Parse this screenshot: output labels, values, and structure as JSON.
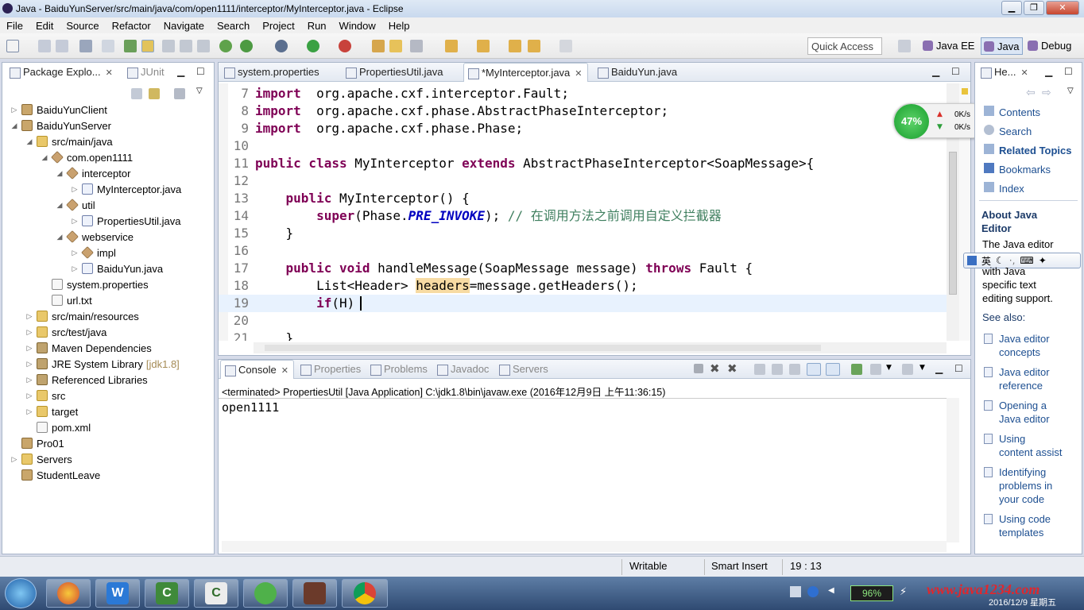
{
  "window": {
    "title": "Java - BaiduYunServer/src/main/java/com/open1111/interceptor/MyInterceptor.java - Eclipse"
  },
  "menu": [
    "File",
    "Edit",
    "Source",
    "Refactor",
    "Navigate",
    "Search",
    "Project",
    "Run",
    "Window",
    "Help"
  ],
  "toolbar": {
    "quick_access": "Quick Access",
    "perspectives": [
      "Java EE",
      "Java",
      "Debug"
    ]
  },
  "explorer": {
    "tabs": [
      "Package Explo...",
      "JUnit"
    ],
    "items": [
      {
        "label": "BaiduYunClient",
        "indent": 0,
        "icon": "proj",
        "twisty": "▷"
      },
      {
        "label": "BaiduYunServer",
        "indent": 0,
        "icon": "proj",
        "twisty": "◢"
      },
      {
        "label": "src/main/java",
        "indent": 1,
        "icon": "folder",
        "twisty": "◢"
      },
      {
        "label": "com.open1111",
        "indent": 2,
        "icon": "pkg",
        "twisty": "◢"
      },
      {
        "label": "interceptor",
        "indent": 3,
        "icon": "pkg",
        "twisty": "◢"
      },
      {
        "label": "MyInterceptor.java",
        "indent": 4,
        "icon": "java",
        "twisty": "▷"
      },
      {
        "label": "util",
        "indent": 3,
        "icon": "pkg",
        "twisty": "◢"
      },
      {
        "label": "PropertiesUtil.java",
        "indent": 4,
        "icon": "java",
        "twisty": "▷"
      },
      {
        "label": "webservice",
        "indent": 3,
        "icon": "pkg",
        "twisty": "◢"
      },
      {
        "label": "impl",
        "indent": 4,
        "icon": "pkg",
        "twisty": "▷"
      },
      {
        "label": "BaiduYun.java",
        "indent": 4,
        "icon": "java",
        "twisty": "▷"
      },
      {
        "label": "system.properties",
        "indent": 2,
        "icon": "file",
        "twisty": ""
      },
      {
        "label": "url.txt",
        "indent": 2,
        "icon": "file",
        "twisty": ""
      },
      {
        "label": "src/main/resources",
        "indent": 1,
        "icon": "folder",
        "twisty": "▷"
      },
      {
        "label": "src/test/java",
        "indent": 1,
        "icon": "folder",
        "twisty": "▷"
      },
      {
        "label": "Maven Dependencies",
        "indent": 1,
        "icon": "lib",
        "twisty": "▷"
      },
      {
        "label": "JRE System Library",
        "indent": 1,
        "icon": "lib",
        "twisty": "▷",
        "suffix": "[jdk1.8]"
      },
      {
        "label": "Referenced Libraries",
        "indent": 1,
        "icon": "lib",
        "twisty": "▷"
      },
      {
        "label": "src",
        "indent": 1,
        "icon": "folder",
        "twisty": "▷"
      },
      {
        "label": "target",
        "indent": 1,
        "icon": "folder",
        "twisty": "▷"
      },
      {
        "label": "pom.xml",
        "indent": 1,
        "icon": "file",
        "twisty": ""
      },
      {
        "label": "Pro01",
        "indent": 0,
        "icon": "proj",
        "twisty": ""
      },
      {
        "label": "Servers",
        "indent": 0,
        "icon": "folder",
        "twisty": "▷"
      },
      {
        "label": "StudentLeave",
        "indent": 0,
        "icon": "proj",
        "twisty": ""
      }
    ]
  },
  "editor": {
    "tabs": [
      "system.properties",
      "PropertiesUtil.java",
      "*MyInterceptor.java",
      "BaiduYun.java"
    ],
    "active_tab": 2,
    "lines": [
      {
        "n": "7",
        "parts": [
          [
            "kw",
            "import"
          ],
          [
            "",
            "  org.apache.cxf.interceptor.Fault;"
          ]
        ]
      },
      {
        "n": "8",
        "parts": [
          [
            "kw",
            "import"
          ],
          [
            "",
            "  org.apache.cxf.phase.AbstractPhaseInterceptor;"
          ]
        ]
      },
      {
        "n": "9",
        "parts": [
          [
            "kw",
            "import"
          ],
          [
            "",
            "  org.apache.cxf.phase.Phase;"
          ]
        ]
      },
      {
        "n": "10",
        "parts": []
      },
      {
        "n": "11",
        "parts": [
          [
            "kw",
            "public class"
          ],
          [
            "",
            " MyInterceptor "
          ],
          [
            "kw",
            "extends"
          ],
          [
            "",
            " AbstractPhaseInterceptor<SoapMessage>{"
          ]
        ]
      },
      {
        "n": "12",
        "parts": []
      },
      {
        "n": "13",
        "parts": [
          [
            "",
            "    "
          ],
          [
            "kw",
            "public"
          ],
          [
            "",
            " MyInterceptor() {"
          ]
        ]
      },
      {
        "n": "14",
        "parts": [
          [
            "",
            "        "
          ],
          [
            "kw",
            "super"
          ],
          [
            "",
            "(Phase."
          ],
          [
            "st",
            "PRE_INVOKE"
          ],
          [
            "",
            "); "
          ],
          [
            "cm",
            "// 在调用方法之前调用自定义拦截器"
          ]
        ]
      },
      {
        "n": "15",
        "parts": [
          [
            "",
            "    }"
          ]
        ]
      },
      {
        "n": "16",
        "parts": []
      },
      {
        "n": "17",
        "parts": [
          [
            "",
            "    "
          ],
          [
            "kw",
            "public void"
          ],
          [
            "",
            " handleMessage(SoapMessage message) "
          ],
          [
            "kw",
            "throws"
          ],
          [
            "",
            " Fault {"
          ]
        ]
      },
      {
        "n": "18",
        "parts": [
          [
            "",
            "        List<Header> "
          ],
          [
            "hl",
            "headers"
          ],
          [
            "",
            "=message.getHeaders();"
          ]
        ]
      },
      {
        "n": "19",
        "parts": [
          [
            "",
            "        "
          ],
          [
            "kw",
            "if"
          ],
          [
            "",
            "(H)"
          ]
        ]
      },
      {
        "n": "20",
        "parts": []
      },
      {
        "n": "21",
        "parts": [
          [
            "",
            "    }"
          ]
        ]
      }
    ]
  },
  "console": {
    "tabs": [
      "Console",
      "Properties",
      "Problems",
      "Javadoc",
      "Servers"
    ],
    "header": "<terminated> PropertiesUtil [Java Application] C:\\jdk1.8\\bin\\javaw.exe (2016年12月9日 上午11:36:15)",
    "output": "open1111"
  },
  "help": {
    "tab": "He...",
    "top_links": [
      "Contents",
      "Search",
      "Related Topics",
      "Bookmarks",
      "Index"
    ],
    "about_title": "About Java Editor",
    "about_text": [
      "The Java editor",
      "with Java",
      "specific text",
      "editing support."
    ],
    "see_also": "See also:",
    "links": [
      [
        "Java editor",
        "concepts"
      ],
      [
        "Java editor",
        "reference"
      ],
      [
        "Opening a",
        "Java editor"
      ],
      [
        "Using",
        "content assist"
      ],
      [
        "Identifying",
        "problems in",
        "your code"
      ],
      [
        "Using code",
        "templates"
      ]
    ]
  },
  "netmon": {
    "percent": "47%",
    "up": "0K/s",
    "down": "0K/s"
  },
  "ime": {
    "label": "英"
  },
  "status": {
    "writable": "Writable",
    "insert": "Smart Insert",
    "position": "19 : 13"
  },
  "taskbar": {
    "battery": "96%",
    "watermark": "www.java1234.com",
    "date": "2016/12/9 星期五"
  }
}
